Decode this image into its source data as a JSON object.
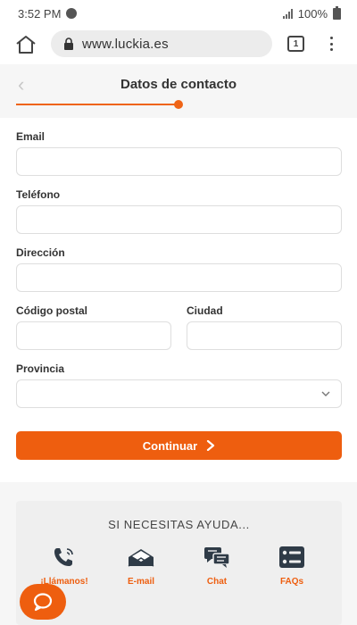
{
  "status_bar": {
    "time": "3:52 PM",
    "battery": "100%"
  },
  "browser": {
    "url": "www.luckia.es",
    "tab_count": "1"
  },
  "header": {
    "title": "Datos de contacto",
    "back_glyph": "‹",
    "progress": 0.5
  },
  "form": {
    "email_label": "Email",
    "phone_label": "Teléfono",
    "address_label": "Dirección",
    "postal_label": "Código postal",
    "city_label": "Ciudad",
    "province_label": "Provincia",
    "email_value": "",
    "phone_value": "",
    "address_value": "",
    "postal_value": "",
    "city_value": "",
    "province_value": ""
  },
  "continue_button": {
    "label": "Continuar",
    "arrow": "›"
  },
  "help": {
    "title": "SI NECESITAS AYUDA...",
    "items": [
      {
        "label": "¡Llámanos!",
        "icon": "phone-icon"
      },
      {
        "label": "E-mail",
        "icon": "mail-icon"
      },
      {
        "label": "Chat",
        "icon": "chat-icon"
      },
      {
        "label": "FAQs",
        "icon": "faq-icon"
      }
    ]
  },
  "colors": {
    "accent": "#ee5e0f",
    "page_bg": "#f6f6f6",
    "input_border": "#dedede"
  }
}
